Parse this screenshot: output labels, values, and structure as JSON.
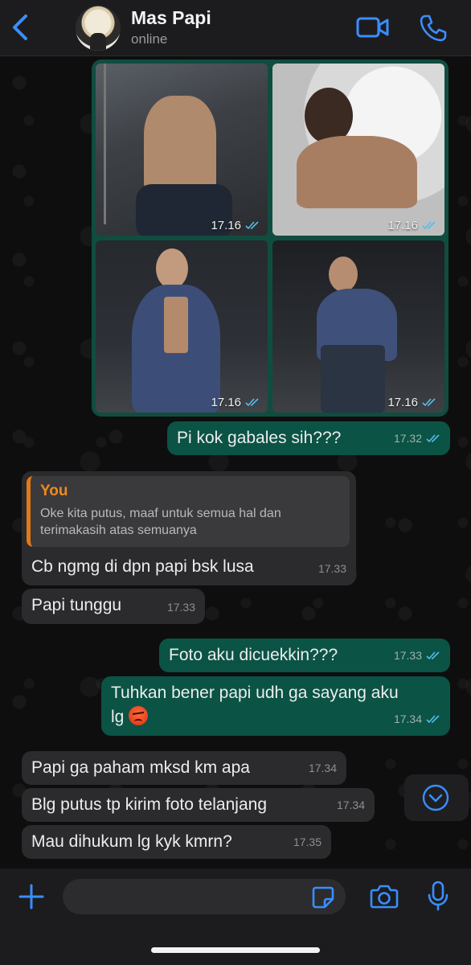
{
  "header": {
    "contact_name": "Mas Papi",
    "status": "online",
    "accent": "#3a8eff"
  },
  "media": {
    "photos": [
      {
        "time": "17.16"
      },
      {
        "time": "17.16"
      },
      {
        "time": "17.16"
      },
      {
        "time": "17.16"
      }
    ]
  },
  "messages": [
    {
      "dir": "out",
      "text": "Pi kok gabales sih???",
      "time": "17.32"
    },
    {
      "dir": "in",
      "reply_author": "You",
      "reply_text": "Oke kita putus, maaf untuk semua hal dan terimakasih atas semuanya",
      "text": "Cb ngmg di dpn papi bsk lusa",
      "time": "17.33"
    },
    {
      "dir": "in",
      "text": "Papi tunggu",
      "time": "17.33"
    },
    {
      "dir": "out",
      "text": "Foto aku dicuekkin???",
      "time": "17.33"
    },
    {
      "dir": "out",
      "text_line1": "Tuhkan bener papi udh ga sayang aku",
      "text_line2": "lg",
      "emoji": "angry-face",
      "time": "17.34"
    },
    {
      "dir": "in",
      "text": "Papi ga paham mksd km apa",
      "time": "17.34"
    },
    {
      "dir": "in",
      "text": "Blg putus tp kirim foto telanjang",
      "time": "17.34"
    },
    {
      "dir": "in",
      "text": "Mau dihukum lg kyk kmrn?",
      "time": "17.35"
    }
  ],
  "composer": {
    "placeholder": ""
  },
  "colors": {
    "outgoing_bubble": "#0b5345",
    "incoming_bubble": "#2b2b2d",
    "read_tick": "#53bdeb"
  }
}
